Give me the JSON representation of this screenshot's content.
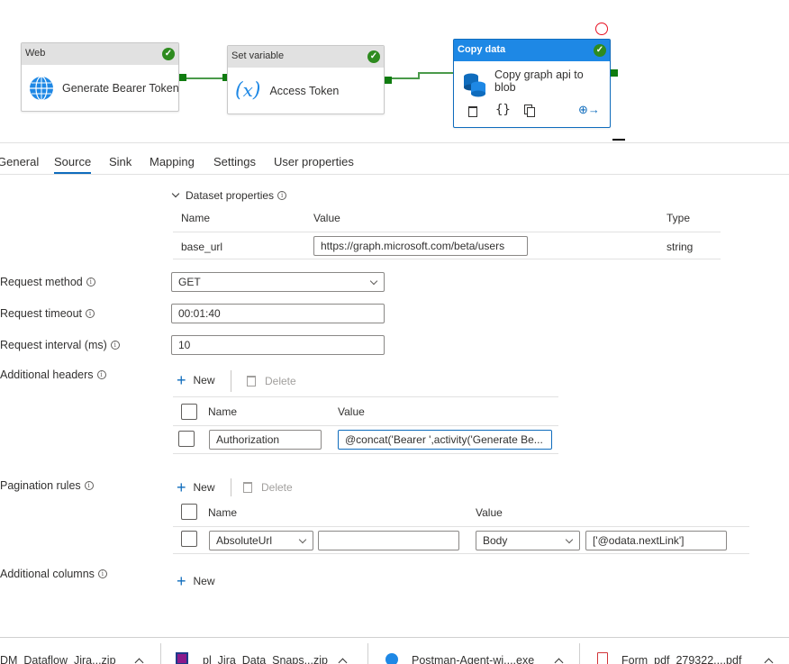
{
  "pipeline": {
    "nodes": [
      {
        "type": "Web",
        "title": "Generate Bearer Token",
        "status": "success"
      },
      {
        "type": "Set variable",
        "title": "Access Token",
        "status": "success"
      },
      {
        "type": "Copy data",
        "title_line1": "Copy graph api to",
        "title_line2": "blob",
        "status": "success"
      }
    ]
  },
  "tabs": [
    "General",
    "Source",
    "Sink",
    "Mapping",
    "Settings",
    "User properties"
  ],
  "active_tab": "Source",
  "dataset_properties": {
    "label": "Dataset properties",
    "columns": {
      "name": "Name",
      "value": "Value",
      "type": "Type"
    },
    "rows": [
      {
        "name": "base_url",
        "value": "https://graph.microsoft.com/beta/users",
        "type": "string"
      }
    ]
  },
  "request_method": {
    "label": "Request method",
    "value": "GET"
  },
  "request_timeout": {
    "label": "Request timeout",
    "value": "00:01:40"
  },
  "request_interval": {
    "label": "Request interval (ms)",
    "value": "10"
  },
  "additional_headers": {
    "label": "Additional headers",
    "new_label": "New",
    "delete_label": "Delete",
    "columns": {
      "name": "Name",
      "value": "Value"
    },
    "rows": [
      {
        "name": "Authorization",
        "value": "@concat('Bearer ',activity('Generate Be..."
      }
    ]
  },
  "pagination_rules": {
    "label": "Pagination rules",
    "new_label": "New",
    "delete_label": "Delete",
    "columns": {
      "name": "Name",
      "value": "Value"
    },
    "rows": [
      {
        "name": "AbsoluteUrl",
        "name_extra": "",
        "value_type": "Body",
        "value": "['@odata.nextLink']"
      }
    ]
  },
  "additional_columns": {
    "label": "Additional columns",
    "new_label": "New"
  },
  "downloads": [
    {
      "name": "DM_Dataflow_Jira...zip"
    },
    {
      "name": "pl_Jira_Data_Snaps...zip"
    },
    {
      "name": "Postman-Agent-wi....exe"
    },
    {
      "name": "Form_pdf_279322....pdf"
    }
  ],
  "icons": {
    "web": "globe-icon",
    "set_variable": "variable-x-icon",
    "copy": "copy-data-icon",
    "success": "check-icon",
    "info": "info-icon"
  },
  "colors": {
    "accent": "#0f6cbd",
    "success": "#2e8b1f",
    "selected_header": "#1e88e5"
  }
}
